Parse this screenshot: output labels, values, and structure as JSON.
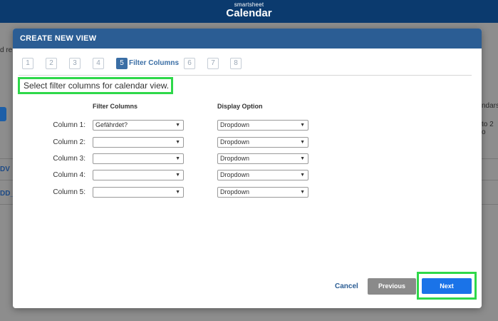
{
  "app": {
    "brand_small": "smartsheet",
    "brand_title": "Calendar"
  },
  "background": {
    "text_left_1": "d re",
    "text_right_1": "ndars",
    "text_right_2": "to 2 o",
    "link_1": "DV",
    "link_2": "DD_"
  },
  "modal": {
    "title": "CREATE NEW VIEW",
    "steps": [
      "1",
      "2",
      "3",
      "4",
      "5",
      "6",
      "7",
      "8"
    ],
    "active_step_label": "Filter Columns",
    "instruction": "Select filter columns for calendar view.",
    "headers": {
      "filter_columns": "Filter Columns",
      "display_option": "Display Option"
    },
    "rows": [
      {
        "label": "Column 1:",
        "filter_value": "Gefährdet?",
        "display_value": "Dropdown"
      },
      {
        "label": "Column 2:",
        "filter_value": "",
        "display_value": "Dropdown"
      },
      {
        "label": "Column 3:",
        "filter_value": "",
        "display_value": "Dropdown"
      },
      {
        "label": "Column 4:",
        "filter_value": "",
        "display_value": "Dropdown"
      },
      {
        "label": "Column 5:",
        "filter_value": "",
        "display_value": "Dropdown"
      }
    ],
    "buttons": {
      "cancel": "Cancel",
      "previous": "Previous",
      "next": "Next"
    }
  }
}
